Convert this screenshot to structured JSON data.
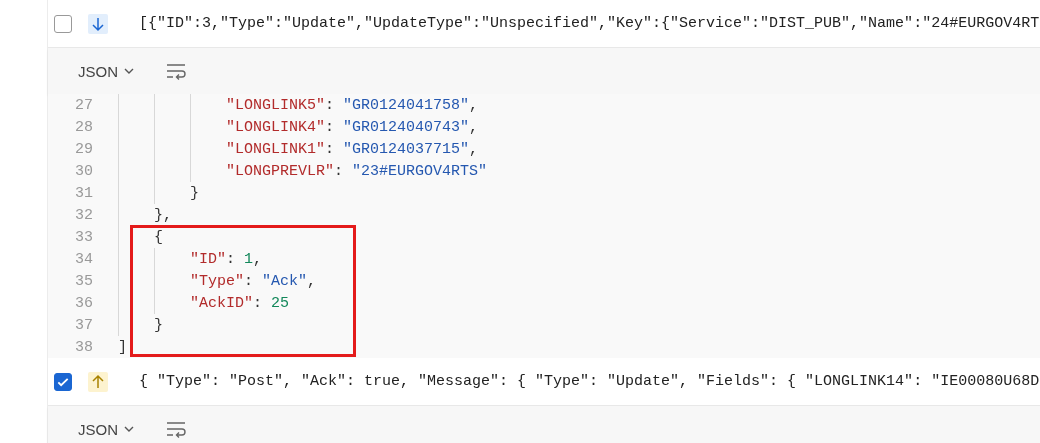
{
  "messages": [
    {
      "kind": "incoming",
      "checked": false,
      "summary": "[{\"ID\":3,\"Type\":\"Update\",\"UpdateType\":\"Unspecified\",\"Key\":{\"Service\":\"DIST_PUB\",\"Name\":\"24#EURGOV4RT",
      "format": "JSON",
      "code": [
        {
          "children": [
            {
              "children": [
                {
                  "children": [
                    {
                      "number": "27",
                      "tokens": [
                        {
                          "kind": "key",
                          "text": "\"LONGLINK5\""
                        },
                        {
                          "kind": "punct",
                          "text": ": "
                        },
                        {
                          "kind": "str",
                          "text": "\"GR0124041758\""
                        },
                        {
                          "kind": "punct",
                          "text": ","
                        }
                      ]
                    },
                    {
                      "number": "28",
                      "tokens": [
                        {
                          "kind": "key",
                          "text": "\"LONGLINK4\""
                        },
                        {
                          "kind": "punct",
                          "text": ": "
                        },
                        {
                          "kind": "str",
                          "text": "\"GR0124040743\""
                        },
                        {
                          "kind": "punct",
                          "text": ","
                        }
                      ]
                    },
                    {
                      "number": "29",
                      "tokens": [
                        {
                          "kind": "key",
                          "text": "\"LONGLINK1\""
                        },
                        {
                          "kind": "punct",
                          "text": ": "
                        },
                        {
                          "kind": "str",
                          "text": "\"GR0124037715\""
                        },
                        {
                          "kind": "punct",
                          "text": ","
                        }
                      ]
                    },
                    {
                      "number": "30",
                      "tokens": [
                        {
                          "kind": "key",
                          "text": "\"LONGPREVLR\""
                        },
                        {
                          "kind": "punct",
                          "text": ": "
                        },
                        {
                          "kind": "str",
                          "text": "\"23#EURGOV4RTS\""
                        }
                      ]
                    }
                  ]
                },
                {
                  "number": "31",
                  "tokens": [
                    {
                      "kind": "punct",
                      "text": "}"
                    }
                  ]
                }
              ]
            },
            {
              "number": "32",
              "tokens": [
                {
                  "kind": "punct",
                  "text": "},"
                }
              ]
            },
            {
              "number": "33",
              "tokens": [
                {
                  "kind": "punct",
                  "text": "{"
                }
              ]
            },
            {
              "children": [
                {
                  "number": "34",
                  "tokens": [
                    {
                      "kind": "key",
                      "text": "\"ID\""
                    },
                    {
                      "kind": "punct",
                      "text": ": "
                    },
                    {
                      "kind": "num",
                      "text": "1"
                    },
                    {
                      "kind": "punct",
                      "text": ","
                    }
                  ]
                },
                {
                  "number": "35",
                  "tokens": [
                    {
                      "kind": "key",
                      "text": "\"Type\""
                    },
                    {
                      "kind": "punct",
                      "text": ": "
                    },
                    {
                      "kind": "str",
                      "text": "\"Ack\""
                    },
                    {
                      "kind": "punct",
                      "text": ","
                    }
                  ]
                },
                {
                  "number": "36",
                  "tokens": [
                    {
                      "kind": "key",
                      "text": "\"AckID\""
                    },
                    {
                      "kind": "punct",
                      "text": ": "
                    },
                    {
                      "kind": "num",
                      "text": "25"
                    }
                  ]
                }
              ]
            },
            {
              "number": "37",
              "tokens": [
                {
                  "kind": "punct",
                  "text": "}"
                }
              ]
            }
          ]
        },
        {
          "number": "38",
          "tokens": [
            {
              "kind": "punct",
              "text": "]"
            }
          ]
        }
      ]
    },
    {
      "kind": "outgoing",
      "checked": true,
      "summary": "{ \"Type\": \"Post\", \"Ack\": true, \"Message\": { \"Type\": \"Update\", \"Fields\": { \"LONGLINK14\": \"IE00080U68D",
      "format": "JSON"
    }
  ]
}
